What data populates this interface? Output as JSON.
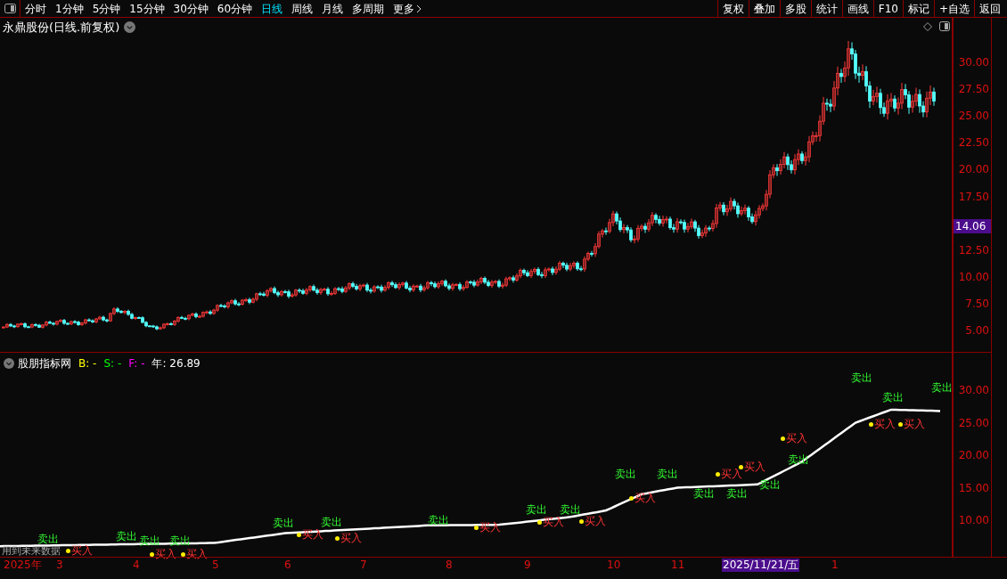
{
  "toolbar": {
    "periods": [
      {
        "label": "分时",
        "selected": false
      },
      {
        "label": "1分钟",
        "selected": false
      },
      {
        "label": "5分钟",
        "selected": false
      },
      {
        "label": "15分钟",
        "selected": false
      },
      {
        "label": "30分钟",
        "selected": false
      },
      {
        "label": "60分钟",
        "selected": false
      },
      {
        "label": "日线",
        "selected": true
      },
      {
        "label": "周线",
        "selected": false
      },
      {
        "label": "月线",
        "selected": false
      },
      {
        "label": "多周期",
        "selected": false
      },
      {
        "label": "更多",
        "selected": false
      }
    ],
    "buttons": [
      "复权",
      "叠加",
      "多股",
      "统计",
      "画线",
      "F10",
      "标记",
      "+自选",
      "返回"
    ]
  },
  "main_chart": {
    "title": "永鼎股份(日线.前复权)",
    "price_axis": [
      "30.00",
      "27.50",
      "25.00",
      "22.50",
      "20.00",
      "17.50",
      "12.50",
      "10.00",
      "7.50",
      "5.00"
    ],
    "current_price": "14.06"
  },
  "indicator": {
    "name": "股朋指标网",
    "legend": [
      {
        "label": "B:",
        "value": "-",
        "color": "#ffff00"
      },
      {
        "label": "S:",
        "value": "-",
        "color": "#00ff00"
      },
      {
        "label": "F:",
        "value": "-",
        "color": "#ff00ff"
      },
      {
        "label": "年:",
        "value": "26.89",
        "color": "#ffffff"
      }
    ],
    "axis": [
      "30.00",
      "25.00",
      "20.00",
      "15.00",
      "10.00"
    ],
    "note": "用到未来数据",
    "signals": [
      {
        "kind": "sell",
        "label": "卖出"
      },
      {
        "kind": "buy",
        "label": "买入"
      },
      {
        "kind": "sell",
        "label": "卖出"
      },
      {
        "kind": "sell",
        "label": "卖出"
      },
      {
        "kind": "buy",
        "label": "买入"
      },
      {
        "kind": "sell",
        "label": "卖出"
      },
      {
        "kind": "buy",
        "label": "买入"
      },
      {
        "kind": "sell",
        "label": "卖出"
      },
      {
        "kind": "buy",
        "label": "买入"
      },
      {
        "kind": "sell",
        "label": "卖出"
      },
      {
        "kind": "buy",
        "label": "买入"
      },
      {
        "kind": "sell",
        "label": "卖出"
      },
      {
        "kind": "buy",
        "label": "买入"
      },
      {
        "kind": "sell",
        "label": "卖出"
      },
      {
        "kind": "buy",
        "label": "买入"
      },
      {
        "kind": "sell",
        "label": "卖出"
      },
      {
        "kind": "buy",
        "label": "买入"
      },
      {
        "kind": "sell",
        "label": "卖出"
      },
      {
        "kind": "buy",
        "label": "买入"
      },
      {
        "kind": "sell",
        "label": "卖出"
      },
      {
        "kind": "sell",
        "label": "卖出"
      },
      {
        "kind": "buy",
        "label": "买入"
      },
      {
        "kind": "sell",
        "label": "卖出"
      },
      {
        "kind": "buy",
        "label": "买入"
      },
      {
        "kind": "sell",
        "label": "卖出"
      },
      {
        "kind": "buy",
        "label": "买入"
      },
      {
        "kind": "sell",
        "label": "卖出"
      },
      {
        "kind": "sell",
        "label": "卖出"
      },
      {
        "kind": "buy",
        "label": "买入"
      },
      {
        "kind": "sell",
        "label": "卖出"
      },
      {
        "kind": "buy",
        "label": "买入"
      },
      {
        "kind": "sell",
        "label": "卖出"
      }
    ]
  },
  "date_axis": [
    {
      "label": "2025年",
      "highlighted": false
    },
    {
      "label": "3",
      "highlighted": false
    },
    {
      "label": "4",
      "highlighted": false
    },
    {
      "label": "5",
      "highlighted": false
    },
    {
      "label": "6",
      "highlighted": false
    },
    {
      "label": "7",
      "highlighted": false
    },
    {
      "label": "8",
      "highlighted": false
    },
    {
      "label": "9",
      "highlighted": false
    },
    {
      "label": "10",
      "highlighted": false
    },
    {
      "label": "11",
      "highlighted": false
    },
    {
      "label": "2025/11/21/五",
      "highlighted": true
    },
    {
      "label": "1",
      "highlighted": false
    }
  ]
}
